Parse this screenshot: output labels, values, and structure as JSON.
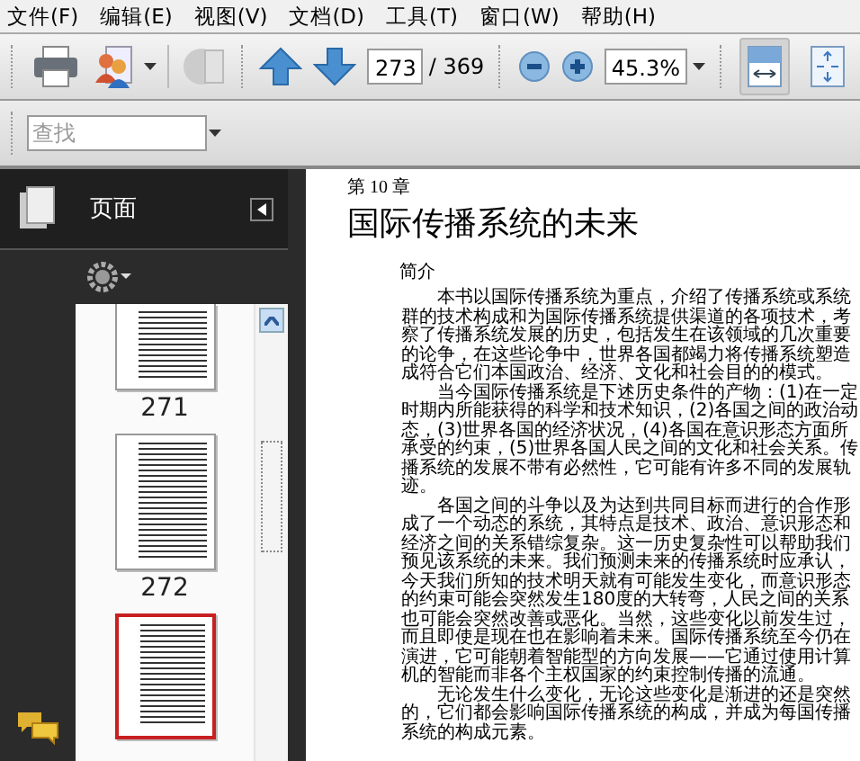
{
  "menu": [
    "文件(F)",
    "编辑(E)",
    "视图(V)",
    "文档(D)",
    "工具(T)",
    "窗口(W)",
    "帮助(H)"
  ],
  "toolbar": {
    "page_value": "273",
    "page_total": "/ 369",
    "zoom_value": "45.3%",
    "fit_width_selected": true,
    "fit_page_selected": false
  },
  "find": {
    "placeholder": "查找"
  },
  "panel": {
    "title": "页面"
  },
  "thumbnails": [
    {
      "label": "271",
      "selected": false
    },
    {
      "label": "272",
      "selected": false
    },
    {
      "selected": true
    }
  ],
  "document": {
    "chapter": "第 10 章",
    "title": "国际传播系统的未来",
    "section": "简介",
    "paragraphs": [
      "本书以国际传播系统为重点，介绍了传播系统或系统群的技术构成和为国际传播系统提供渠道的各项技术，考察了传播系统发展的历史，包括发生在该领域的几次重要的论争，在这些论争中，世界各国都竭力将传播系统塑造成符合它们本国政治、经济、文化和社会目的的模式。",
      "当今国际传播系统是下述历史条件的产物：(1)在一定时期内所能获得的科学和技术知识，(2)各国之间的政治动态，(3)世界各国的经济状况，(4)各国在意识形态方面所承受的约束，(5)世界各国人民之间的文化和社会关系。传播系统的发展不带有必然性，它可能有许多不同的发展轨迹。",
      "各国之间的斗争以及为达到共同目标而进行的合作形成了一个动态的系统，其特点是技术、政治、意识形态和经济之间的关系错综复杂。这一历史复杂性可以帮助我们预见该系统的未来。我们预测未来的传播系统时应承认，今天我们所知的技术明天就有可能发生变化，而意识形态的约束可能会突然发生180度的大转弯，人民之间的关系也可能会突然改善或恶化。当然，这些变化以前发生过，而且即使是现在也在影响着未来。国际传播系统至今仍在演进，它可能朝着智能型的方向发展——它通过使用计算机的智能而非各个主权国家的约束控制传播的流通。",
      "无论发生什么变化，无论这些变化是渐进的还是突然的，它们都会影响国际传播系统的构成，并成为每国传播系统的构成元素。"
    ]
  }
}
